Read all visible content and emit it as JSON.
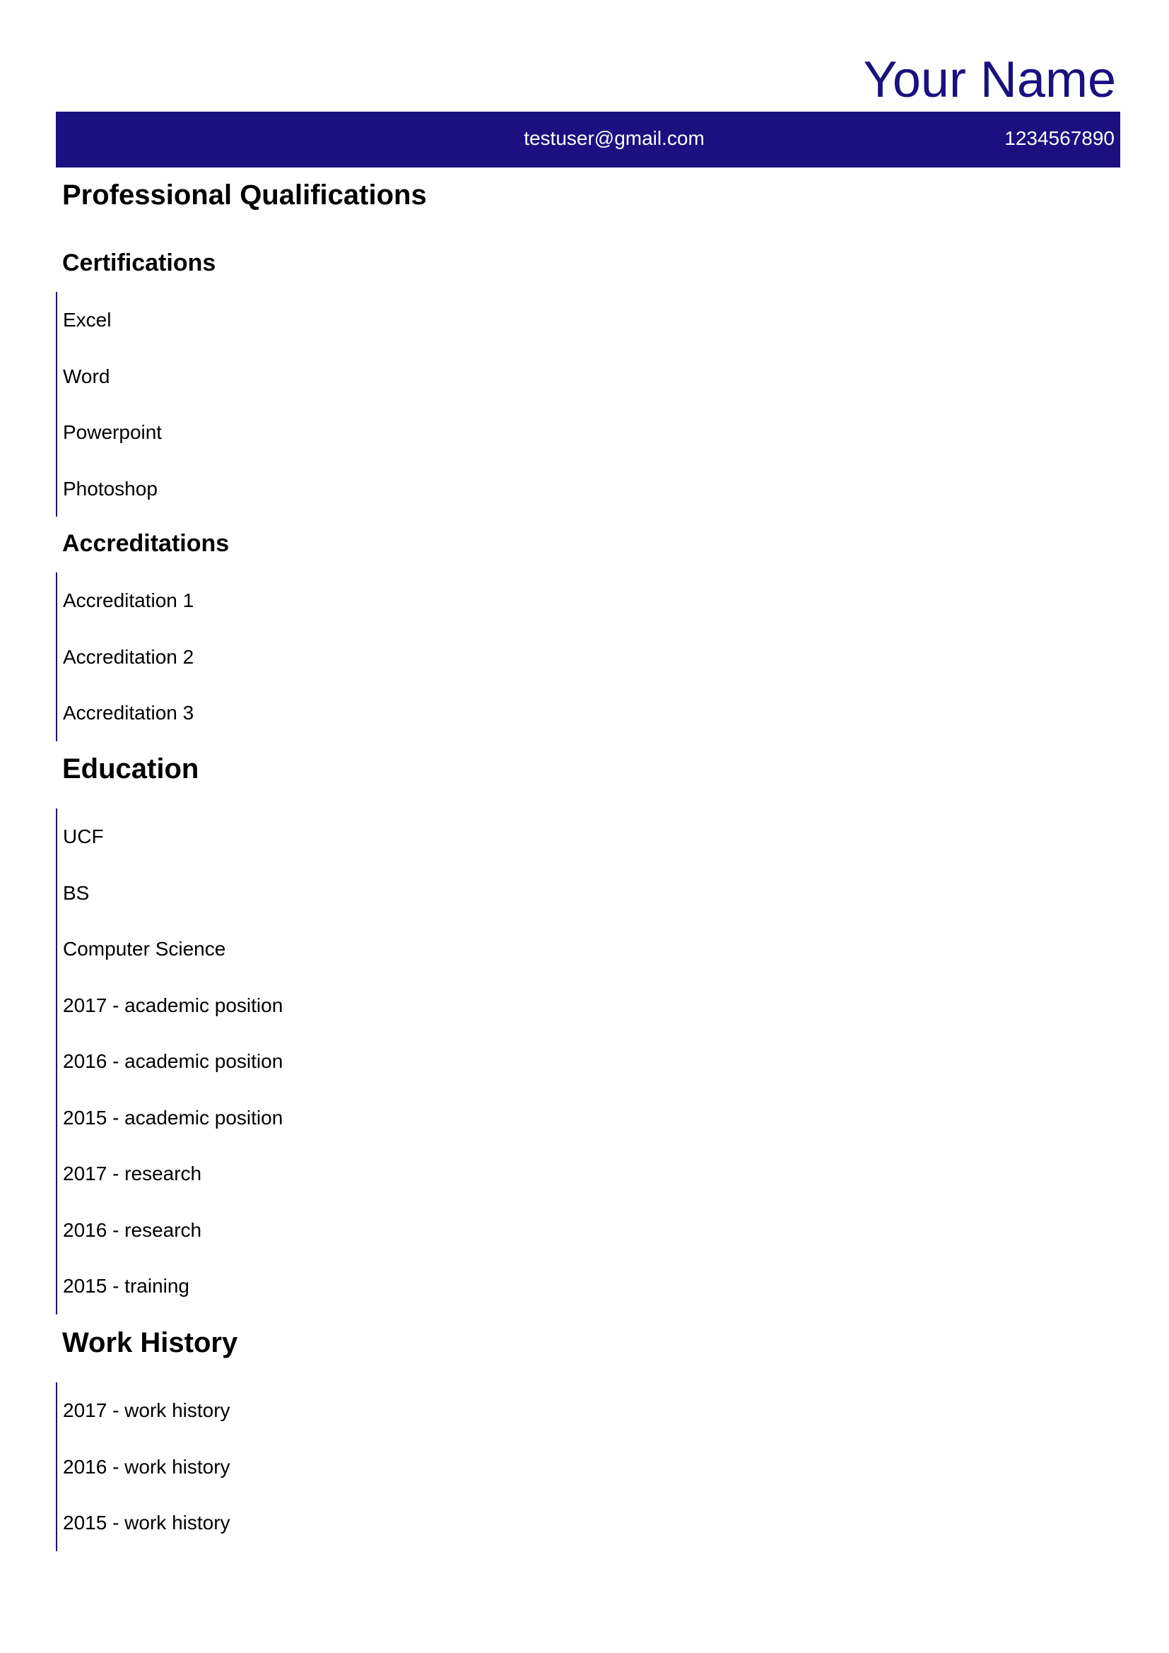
{
  "header": {
    "name": "Your Name",
    "email": "testuser@gmail.com",
    "phone": "1234567890"
  },
  "professional_qualifications": {
    "title": "Professional Qualifications",
    "certifications": {
      "title": "Certifications",
      "items": [
        "Excel",
        "Word",
        "Powerpoint",
        "Photoshop"
      ]
    },
    "accreditations": {
      "title": "Accreditations",
      "items": [
        "Accreditation 1",
        "Accreditation 2",
        "Accreditation 3"
      ]
    }
  },
  "education": {
    "title": "Education",
    "items": [
      "UCF",
      "BS",
      "Computer Science",
      "2017 - academic position",
      "2016 - academic position",
      "2015 - academic position",
      "2017 - research",
      "2016 - research",
      "2015 - training"
    ]
  },
  "work_history": {
    "title": "Work History",
    "items": [
      "2017 - work history",
      "2016 - work history",
      "2015 - work history"
    ]
  },
  "colors": {
    "accent": "#1a1080",
    "text": "#000000",
    "background": "#ffffff"
  }
}
